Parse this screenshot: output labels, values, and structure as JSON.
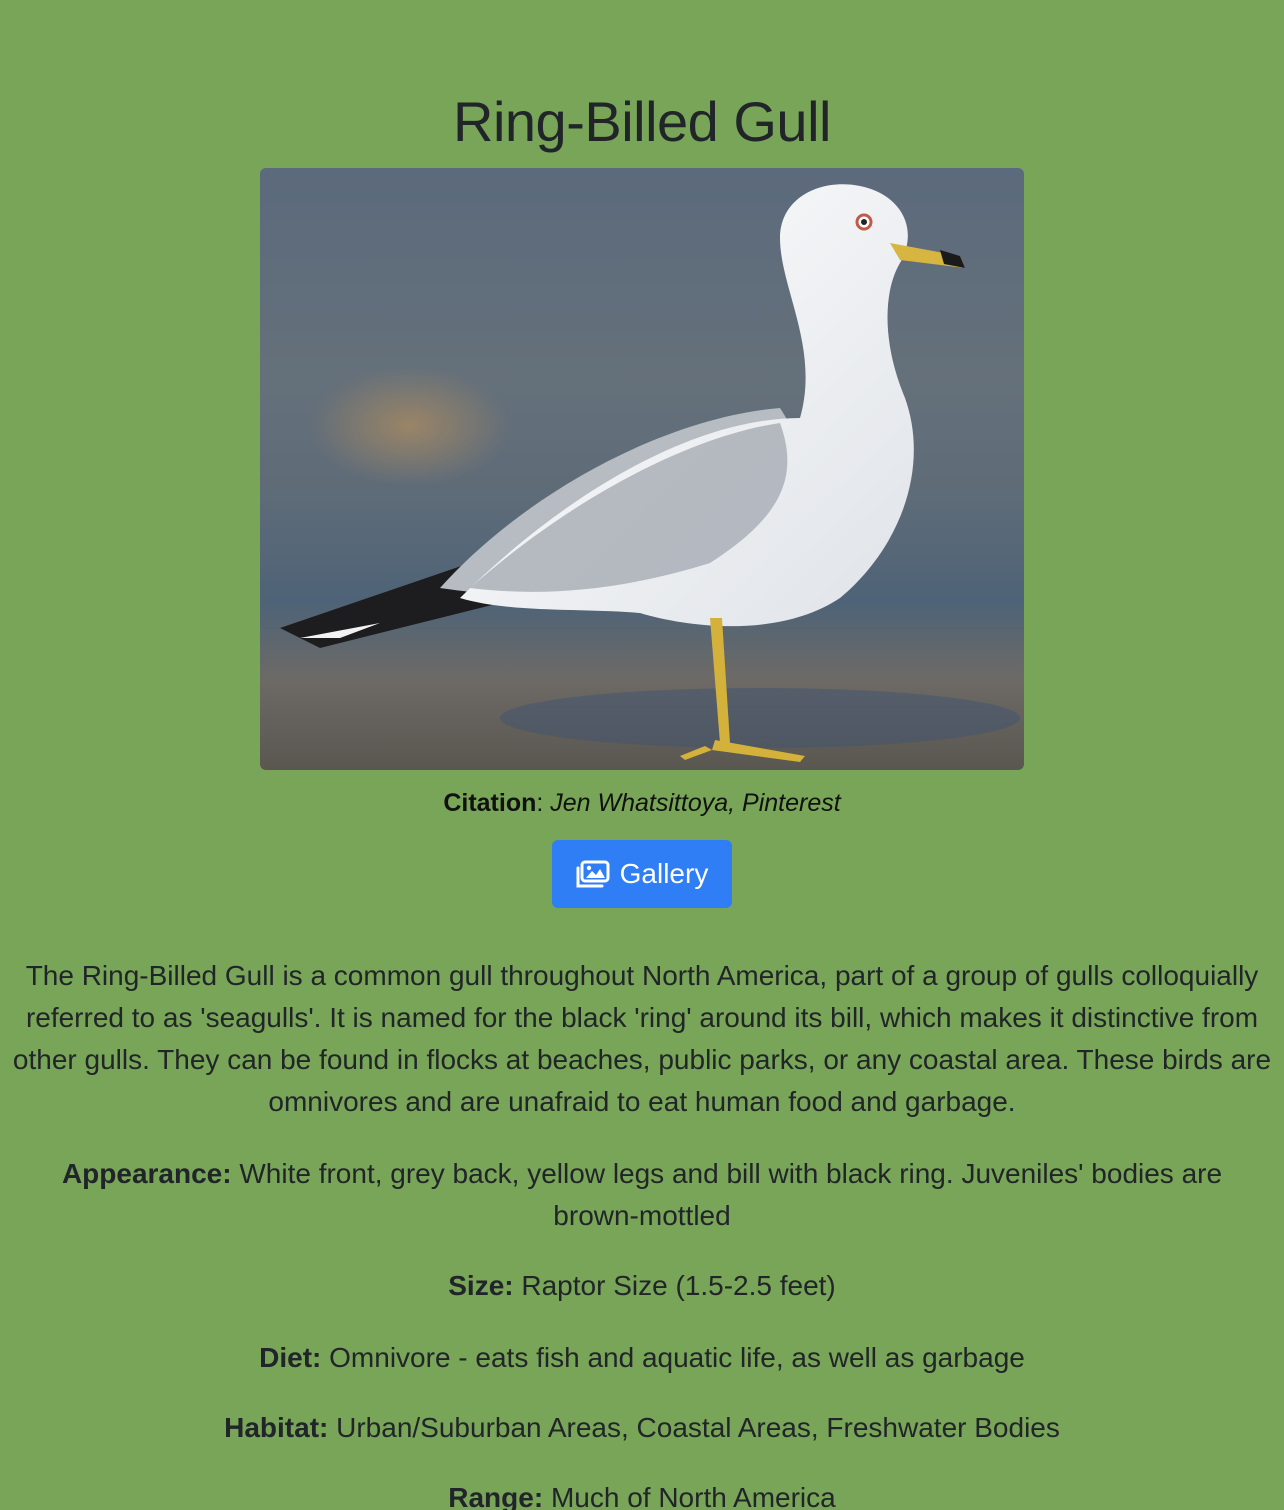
{
  "bird": {
    "name": "Ring-Billed Gull",
    "citation_label": "Citation",
    "citation_source": "Jen Whatsittoya, Pinterest",
    "gallery_label": "Gallery",
    "description": "The Ring-Billed Gull is a common gull throughout North America, part of a group of gulls colloquially referred to as 'seagulls'. It is named for the black 'ring' around its bill, which makes it distinctive from other gulls. They can be found in flocks at beaches, public parks, or any coastal area. These birds are omnivores and are unafraid to eat human food and garbage.",
    "facts": [
      {
        "label": "Appearance:",
        "value": "White front, grey back, yellow legs and bill with black ring. Juveniles' bodies are brown-mottled"
      },
      {
        "label": "Size:",
        "value": "Raptor Size (1.5-2.5 feet)"
      },
      {
        "label": "Diet:",
        "value": "Omnivore - eats fish and aquatic life, as well as garbage"
      },
      {
        "label": "Habitat:",
        "value": "Urban/Suburban Areas, Coastal Areas, Freshwater Bodies"
      },
      {
        "label": "Range:",
        "value": "Much of North America"
      }
    ]
  },
  "colors": {
    "background": "#78a557",
    "button": "#2f7ef5"
  },
  "icons": {
    "gallery": "images-icon"
  }
}
